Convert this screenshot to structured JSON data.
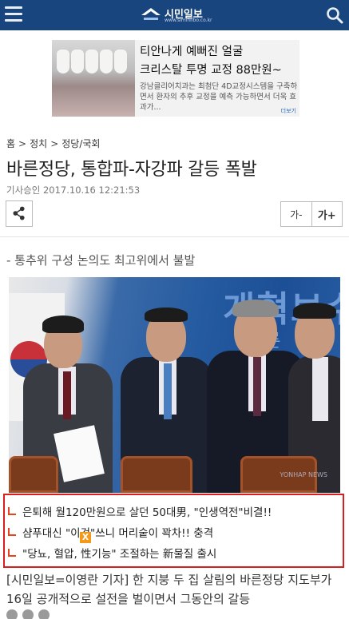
{
  "header": {
    "logo_text": "시민일보",
    "logo_sub": "www.siminilbo.co.kr",
    "menu_icon": "hamburger-icon",
    "search_icon": "search-icon",
    "bar_color": "#18457e"
  },
  "ad": {
    "title_line1": "티안나게 예뻐진 얼굴",
    "title_line2": "크리스탈 투명 교정 88만원~",
    "desc": "강남클리어치과는 최첨단 4D교정시스템을 구축하면서 환자의 추후 교정을 예측 가능하면서 더욱 효과가...",
    "more": "더보기"
  },
  "breadcrumb": {
    "home": "홈",
    "sep": ">",
    "section": "정치",
    "subsection": "정당/국회"
  },
  "article": {
    "headline": "바른정당, 통합파-자강파 갈등 폭발",
    "meta_label": "기사승인",
    "date": "2017.10.16",
    "time": "12:21:53",
    "subtitle": "- 통추위 구성 논의도 최고위에서 불발",
    "body": "[시민일보=이영란 기자] 한 지붕 두 집 살림의 바른정당 지도부가 16일 공개적으로 설전을 벌이면서 그동안의 갈등"
  },
  "toolbar": {
    "share_icon": "share-icon",
    "font_smaller": "가-",
    "font_larger": "가+"
  },
  "photo": {
    "bg_text": "개혁보수",
    "bg_text2": "바른",
    "watermark": "YONHAP NEWS"
  },
  "related": {
    "items": [
      "은퇴해 월120만원으로 살던 50대男, \"인생역전\"비결!!",
      "샴푸대신 \"이것\"쓰니 머리숱이 꽉차!! 충격",
      "\"당뇨, 혈압, 性기능\" 조절하는 新물질 출시"
    ],
    "close_label": "X",
    "border_color": "#d81e1e"
  }
}
